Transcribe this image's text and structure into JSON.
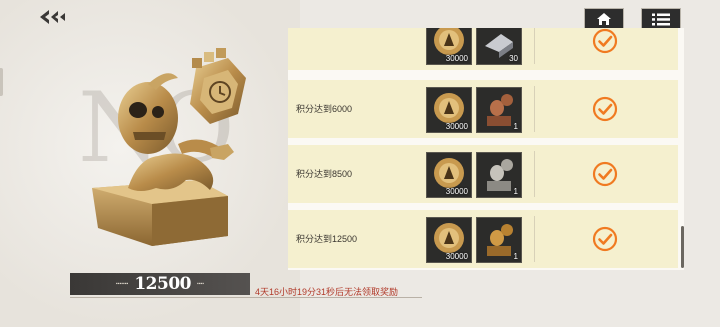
{
  "score": {
    "value": "12500"
  },
  "countdown": "4天16小时19分31秒后无法领取奖励",
  "rows": [
    {
      "label": "",
      "coin_qty": "30000",
      "item_qty": "30"
    },
    {
      "label": "积分达到6000",
      "coin_qty": "30000",
      "item_qty": "1"
    },
    {
      "label": "积分达到8500",
      "coin_qty": "30000",
      "item_qty": "1"
    },
    {
      "label": "积分达到12500",
      "coin_qty": "30000",
      "item_qty": "1"
    }
  ],
  "colors": {
    "accent": "#f07a21",
    "panel_row": "#f5f0cf",
    "countdown": "#b13a2a"
  }
}
